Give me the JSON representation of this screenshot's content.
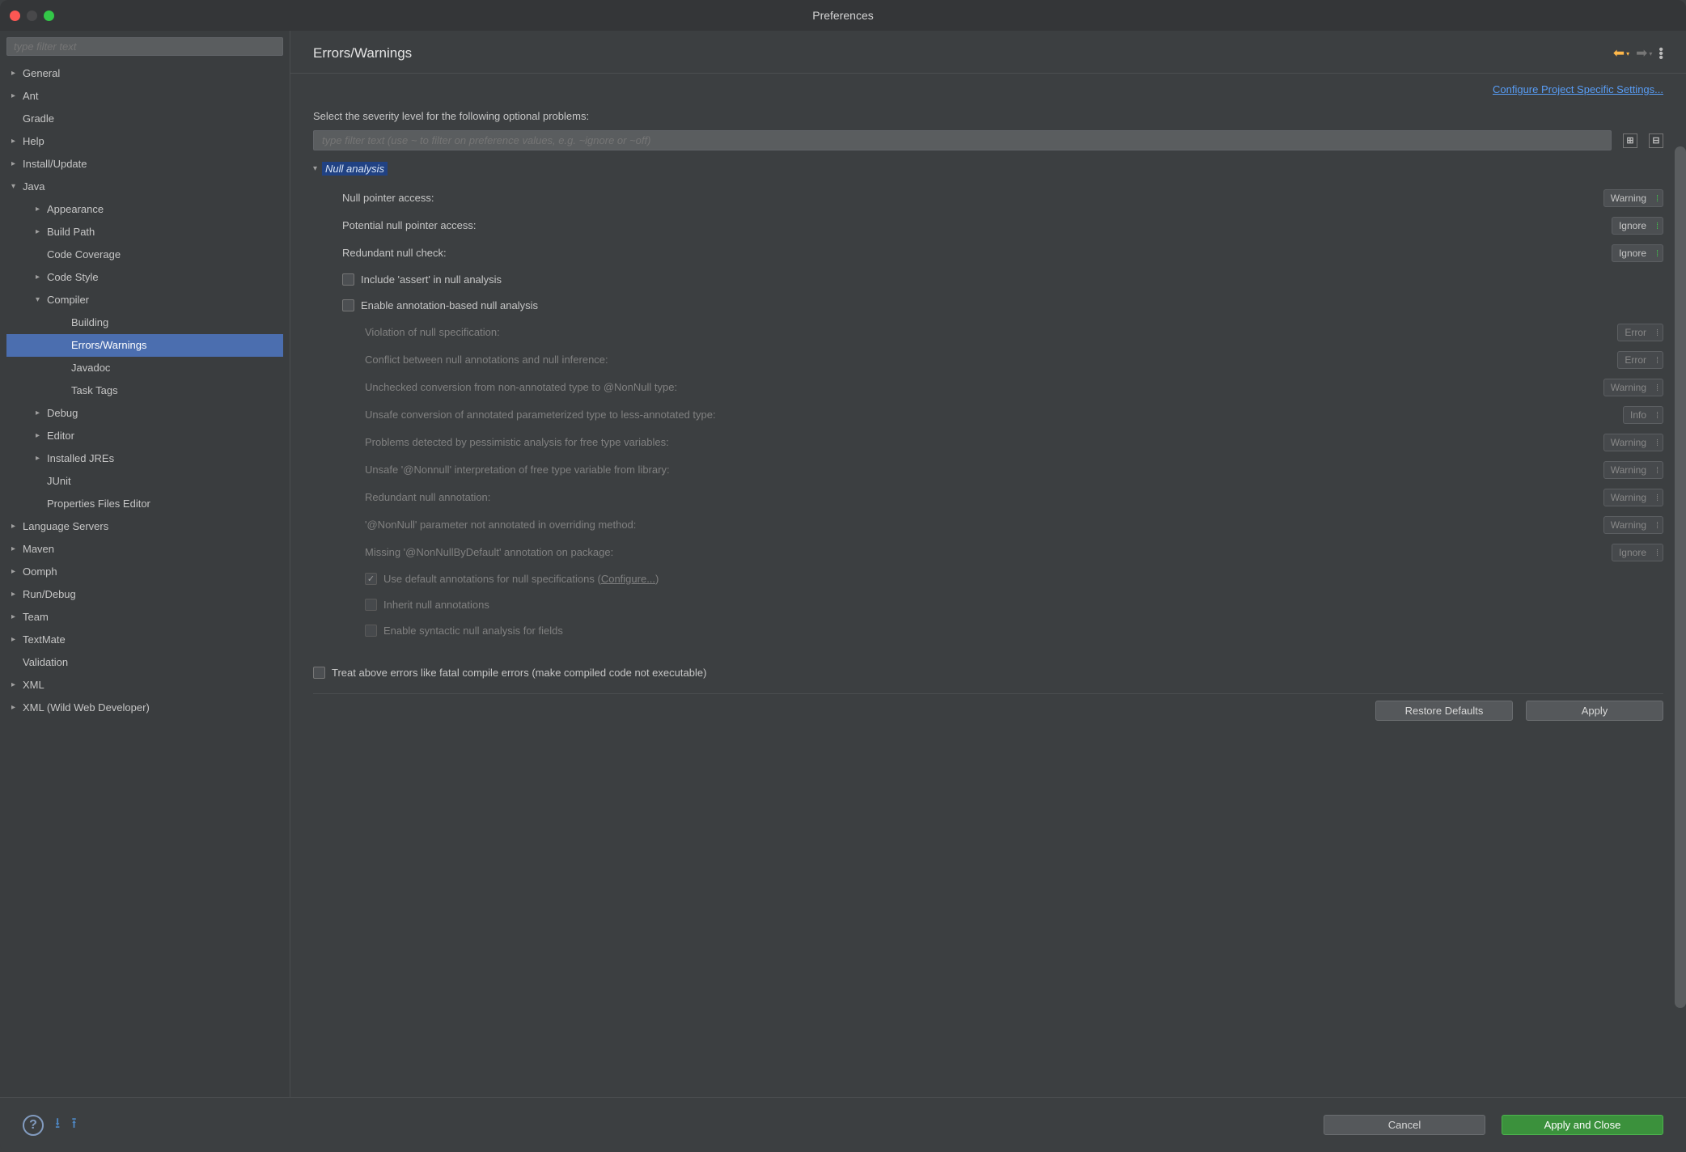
{
  "window_title": "Preferences",
  "sidebar_filter_placeholder": "type filter text",
  "tree": [
    {
      "label": "General",
      "indent": 0,
      "arrow": "▸"
    },
    {
      "label": "Ant",
      "indent": 0,
      "arrow": "▸"
    },
    {
      "label": "Gradle",
      "indent": 0,
      "arrow": " "
    },
    {
      "label": "Help",
      "indent": 0,
      "arrow": "▸"
    },
    {
      "label": "Install/Update",
      "indent": 0,
      "arrow": "▸"
    },
    {
      "label": "Java",
      "indent": 0,
      "arrow": "▾"
    },
    {
      "label": "Appearance",
      "indent": 1,
      "arrow": "▸"
    },
    {
      "label": "Build Path",
      "indent": 1,
      "arrow": "▸"
    },
    {
      "label": "Code Coverage",
      "indent": 1,
      "arrow": " "
    },
    {
      "label": "Code Style",
      "indent": 1,
      "arrow": "▸"
    },
    {
      "label": "Compiler",
      "indent": 1,
      "arrow": "▾"
    },
    {
      "label": "Building",
      "indent": 2,
      "arrow": " "
    },
    {
      "label": "Errors/Warnings",
      "indent": 2,
      "arrow": " ",
      "selected": true
    },
    {
      "label": "Javadoc",
      "indent": 2,
      "arrow": " "
    },
    {
      "label": "Task Tags",
      "indent": 2,
      "arrow": " "
    },
    {
      "label": "Debug",
      "indent": 1,
      "arrow": "▸"
    },
    {
      "label": "Editor",
      "indent": 1,
      "arrow": "▸"
    },
    {
      "label": "Installed JREs",
      "indent": 1,
      "arrow": "▸"
    },
    {
      "label": "JUnit",
      "indent": 1,
      "arrow": " "
    },
    {
      "label": "Properties Files Editor",
      "indent": 1,
      "arrow": " "
    },
    {
      "label": "Language Servers",
      "indent": 0,
      "arrow": "▸"
    },
    {
      "label": "Maven",
      "indent": 0,
      "arrow": "▸"
    },
    {
      "label": "Oomph",
      "indent": 0,
      "arrow": "▸"
    },
    {
      "label": "Run/Debug",
      "indent": 0,
      "arrow": "▸"
    },
    {
      "label": "Team",
      "indent": 0,
      "arrow": "▸"
    },
    {
      "label": "TextMate",
      "indent": 0,
      "arrow": "▸"
    },
    {
      "label": "Validation",
      "indent": 0,
      "arrow": " "
    },
    {
      "label": "XML",
      "indent": 0,
      "arrow": "▸"
    },
    {
      "label": "XML (Wild Web Developer)",
      "indent": 0,
      "arrow": "▸"
    }
  ],
  "page_title": "Errors/Warnings",
  "project_link": "Configure Project Specific Settings...",
  "description": "Select the severity level for the following optional problems:",
  "main_filter_placeholder": "type filter text (use ~ to filter on preference values, e.g. ~ignore or ~off)",
  "section_title": "Null analysis",
  "rows": {
    "null_pointer": {
      "label": "Null pointer access:",
      "value": "Warning"
    },
    "potential_null": {
      "label": "Potential null pointer access:",
      "value": "Ignore"
    },
    "redundant_check": {
      "label": "Redundant null check:",
      "value": "Ignore"
    },
    "include_assert": "Include 'assert' in null analysis",
    "enable_anno": "Enable annotation-based null analysis",
    "violation": {
      "label": "Violation of null specification:",
      "value": "Error"
    },
    "conflict": {
      "label": "Conflict between null annotations and null inference:",
      "value": "Error"
    },
    "unchecked": {
      "label": "Unchecked conversion from non-annotated type to @NonNull type:",
      "value": "Warning"
    },
    "unsafe_conv": {
      "label": "Unsafe conversion of annotated parameterized type to less-annotated type:",
      "value": "Info"
    },
    "pessimistic": {
      "label": "Problems detected by pessimistic analysis for free type variables:",
      "value": "Warning"
    },
    "unsafe_nonnull": {
      "label": "Unsafe '@Nonnull' interpretation of free type variable from library:",
      "value": "Warning"
    },
    "redundant_anno": {
      "label": "Redundant null annotation:",
      "value": "Warning"
    },
    "param_not_anno": {
      "label": "'@NonNull' parameter not annotated in overriding method:",
      "value": "Warning"
    },
    "missing_default": {
      "label": "Missing '@NonNullByDefault' annotation on package:",
      "value": "Ignore"
    },
    "use_default_prefix": "Use default annotations for null specifications (",
    "use_default_link": "Configure...",
    "use_default_suffix": ")",
    "inherit": "Inherit null annotations",
    "syntactic": "Enable syntactic null analysis for fields"
  },
  "treat_fatal": "Treat above errors like fatal compile errors (make compiled code not executable)",
  "buttons": {
    "restore": "Restore Defaults",
    "apply": "Apply",
    "cancel": "Cancel",
    "apply_close": "Apply and Close"
  }
}
